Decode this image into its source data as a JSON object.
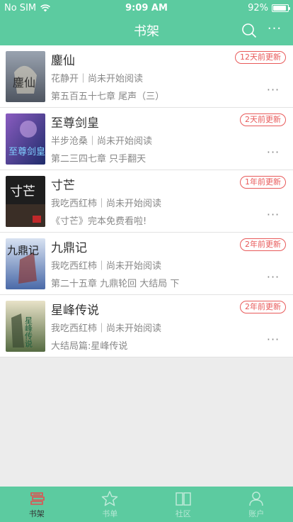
{
  "status": {
    "carrier": "No SIM",
    "time": "9:09 AM",
    "battery": "92%",
    "battery_level": 0.92
  },
  "nav": {
    "title": "书架"
  },
  "books": [
    {
      "title": "鏖仙",
      "meta": "花静开｜尚未开始阅读",
      "chapter": "第五百五十七章 尾声（三）",
      "badge": "12天前更新",
      "cover_color": "#6b7380"
    },
    {
      "title": "至尊剑皇",
      "meta": "半步沧桑｜尚未开始阅读",
      "chapter": "第二三四七章 只手翻天",
      "badge": "2天前更新",
      "cover_color": "#3c3f83"
    },
    {
      "title": "寸芒",
      "meta": "我吃西红柿｜尚未开始阅读",
      "chapter": "《寸芒》完本免费看啦!",
      "badge": "1年前更新",
      "cover_color": "#2a2a2a"
    },
    {
      "title": "九鼎记",
      "meta": "我吃西红柿｜尚未开始阅读",
      "chapter": "第二十五章 九鼎轮回 大结局 下",
      "badge": "2年前更新",
      "cover_color": "#6b86b8"
    },
    {
      "title": "星峰传说",
      "meta": "我吃西红柿｜尚未开始阅读",
      "chapter": "大结局篇:星峰传说",
      "badge": "2年前更新",
      "cover_color": "#6f8b58"
    }
  ],
  "cover_text": [
    "鏖仙",
    "至尊剑皇",
    "寸芒",
    "九鼎记",
    "星峰传说"
  ],
  "tabs": [
    {
      "label": "书架",
      "icon": "bookshelf-icon",
      "active": true
    },
    {
      "label": "书单",
      "icon": "star-icon",
      "active": false
    },
    {
      "label": "社区",
      "icon": "book-open-icon",
      "active": false
    },
    {
      "label": "账户",
      "icon": "person-icon",
      "active": false
    }
  ],
  "colors": {
    "primary": "#5ccba0",
    "badge": "#e85a5a",
    "active_tab": "#e05050"
  }
}
